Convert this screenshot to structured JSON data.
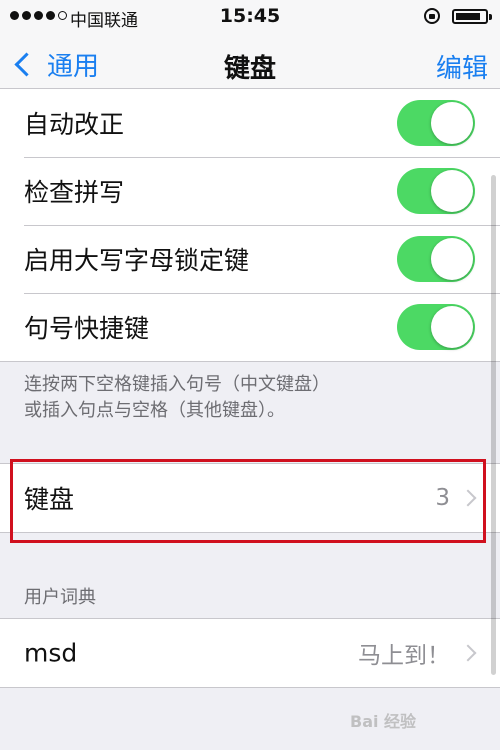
{
  "status_bar": {
    "carrier": "中国联通",
    "time": "15:45"
  },
  "nav": {
    "back_label": "通用",
    "title": "键盘",
    "edit_label": "编辑"
  },
  "toggles": [
    {
      "label": "自动改正",
      "on": true
    },
    {
      "label": "检查拼写",
      "on": true
    },
    {
      "label": "启用大写字母锁定键",
      "on": true
    },
    {
      "label": "句号快捷键",
      "on": true
    }
  ],
  "footer_note": {
    "line1": "连按两下空格键插入句号（中文键盘）",
    "line2": "或插入句点与空格（其他键盘）。"
  },
  "keyboards": {
    "label": "键盘",
    "count": "3"
  },
  "user_dictionary": {
    "header": "用户词典",
    "entry_label": "msd",
    "entry_value": "马上到！"
  },
  "watermark": "Bai 经验",
  "colors": {
    "accent": "#1a7ff0",
    "toggle_on": "#4cd964",
    "highlight": "#d0101e"
  }
}
